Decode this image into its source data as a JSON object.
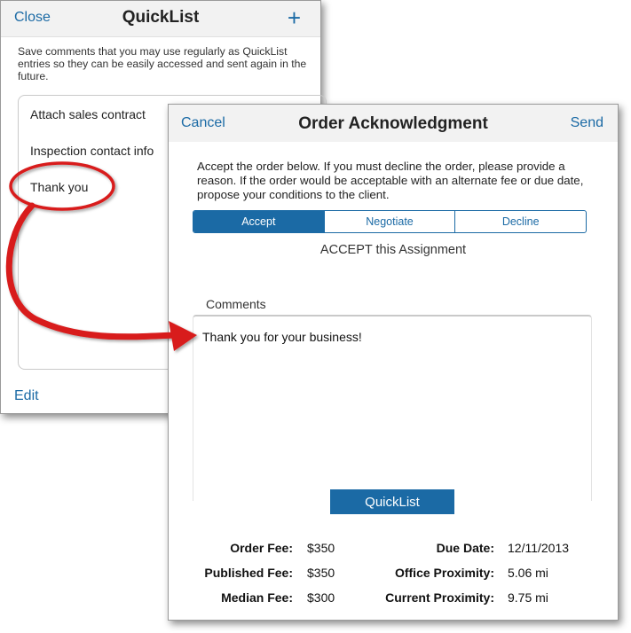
{
  "quicklist": {
    "close_label": "Close",
    "title": "QuickList",
    "add_label": "+",
    "description": "Save comments that you may use regularly as QuickList entries so they can be easily accessed and sent again in the future.",
    "items": [
      {
        "label": "Attach sales contract"
      },
      {
        "label": "Inspection contact info"
      },
      {
        "label": "Thank you"
      }
    ],
    "edit_label": "Edit"
  },
  "order": {
    "cancel_label": "Cancel",
    "title": "Order Acknowledgment",
    "send_label": "Send",
    "description": "Accept the order below.  If you must decline the order, please provide a reason.  If the order would be acceptable with an alternate fee or due date, propose your conditions to the client.",
    "segments": [
      {
        "label": "Accept",
        "active": true
      },
      {
        "label": "Negotiate",
        "active": false
      },
      {
        "label": "Decline",
        "active": false
      }
    ],
    "status_text": "ACCEPT this Assignment",
    "comments_label": "Comments",
    "comments_value": "Thank you for your business!",
    "quicklist_button": "QuickList",
    "fees_left": [
      {
        "label": "Order Fee:",
        "value": "$350"
      },
      {
        "label": "Published Fee:",
        "value": "$350"
      },
      {
        "label": "Median Fee:",
        "value": "$300"
      }
    ],
    "fees_right": [
      {
        "label": "Due Date:",
        "value": "12/11/2013"
      },
      {
        "label": "Office Proximity:",
        "value": "5.06 mi"
      },
      {
        "label": "Current Proximity:",
        "value": "9.75 mi"
      }
    ]
  },
  "colors": {
    "accent": "#1b6aa5",
    "annotation": "#d81a1a"
  }
}
